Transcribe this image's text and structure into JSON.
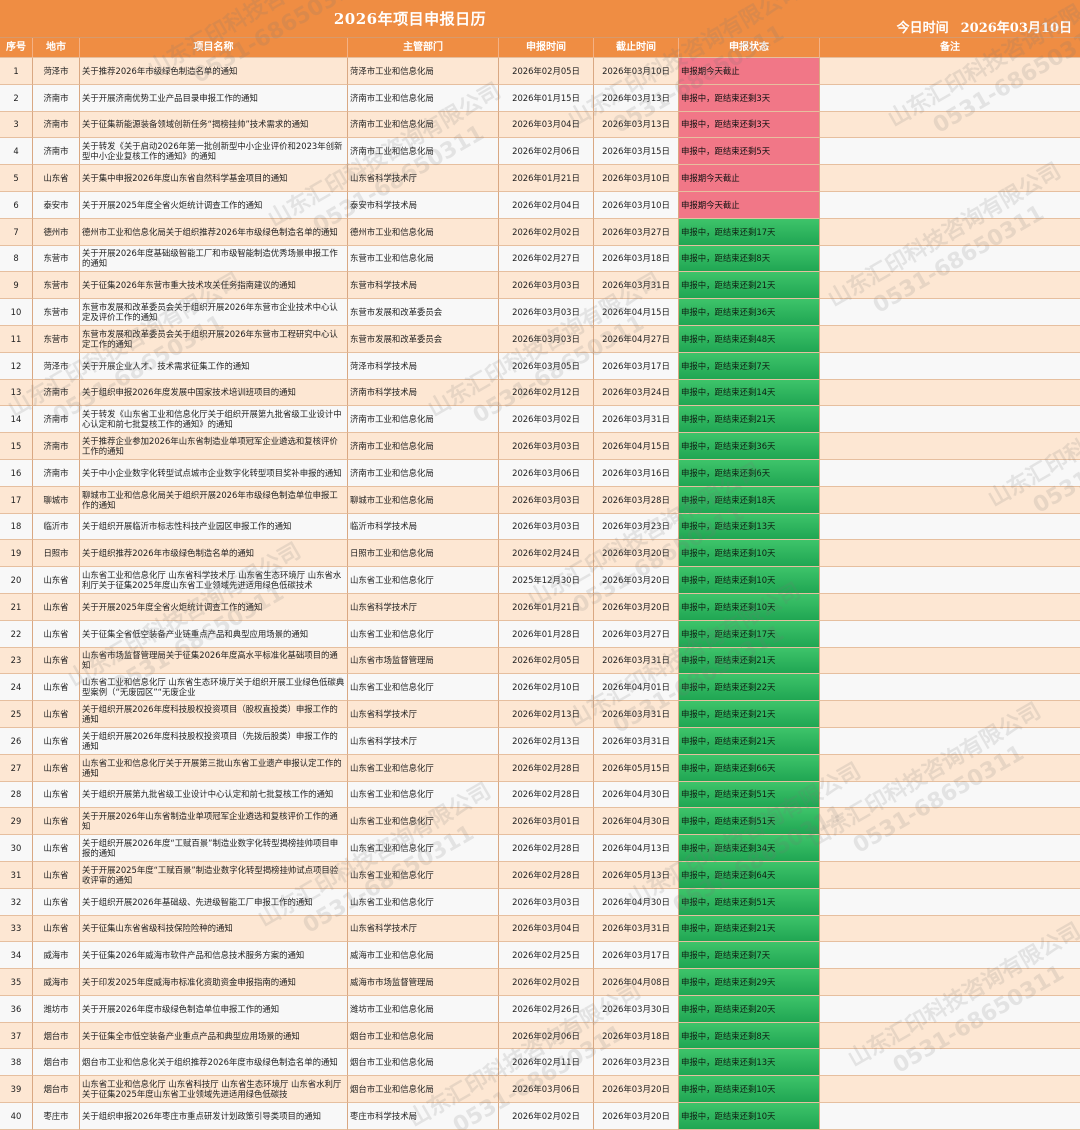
{
  "header": {
    "title": "2026年项目申报日历",
    "today_label": "今日时间",
    "today_value": "2026年03月10日"
  },
  "columns": [
    "序号",
    "地市",
    "项目名称",
    "主管部门",
    "申报时间",
    "截止时间",
    "申报状态",
    "备注"
  ],
  "colors": {
    "header": "#ef8d43",
    "due_today": "#f17787",
    "active": "#2fb55e",
    "row_alt": "#fde7d3"
  },
  "rows": [
    {
      "no": "1",
      "city": "菏泽市",
      "name": "关于推荐2026年市级绿色制造名单的通知",
      "dept": "菏泽市工业和信息化局",
      "start": "2026年02月05日",
      "end": "2026年03月10日",
      "status": "申报期今天截止",
      "kind": "due"
    },
    {
      "no": "2",
      "city": "济南市",
      "name": "关于开展济南优势工业产品目录申报工作的通知",
      "dept": "济南市工业和信息化局",
      "start": "2026年01月15日",
      "end": "2026年03月13日",
      "status": "申报中，距结束还剩3天",
      "kind": "due"
    },
    {
      "no": "3",
      "city": "济南市",
      "name": "关于征集新能源装备领域创新任务“揭榜挂帅”技术需求的通知",
      "dept": "济南市工业和信息化局",
      "start": "2026年03月04日",
      "end": "2026年03月13日",
      "status": "申报中，距结束还剩3天",
      "kind": "due"
    },
    {
      "no": "4",
      "city": "济南市",
      "name": "关于转发《关于启动2026年第一批创新型中小企业评价和2023年创新型中小企业复核工作的通知》的通知",
      "dept": "济南市工业和信息化局",
      "start": "2026年02月06日",
      "end": "2026年03月15日",
      "status": "申报中，距结束还剩5天",
      "kind": "due"
    },
    {
      "no": "5",
      "city": "山东省",
      "name": "关于集中申报2026年度山东省自然科学基金项目的通知",
      "dept": "山东省科学技术厅",
      "start": "2026年01月21日",
      "end": "2026年03月10日",
      "status": "申报期今天截止",
      "kind": "due"
    },
    {
      "no": "6",
      "city": "泰安市",
      "name": "关于开展2025年度全省火炬统计调查工作的通知",
      "dept": "泰安市科学技术局",
      "start": "2026年02月04日",
      "end": "2026年03月10日",
      "status": "申报期今天截止",
      "kind": "due"
    },
    {
      "no": "7",
      "city": "德州市",
      "name": "德州市工业和信息化局关于组织推荐2026年市级绿色制造名单的通知",
      "dept": "德州市工业和信息化局",
      "start": "2026年02月02日",
      "end": "2026年03月27日",
      "status": "申报中，距结束还剩17天",
      "kind": "active"
    },
    {
      "no": "8",
      "city": "东营市",
      "name": "关于开展2026年度基础级智能工厂和市级智能制造优秀场景申报工作的通知",
      "dept": "东营市工业和信息化局",
      "start": "2026年02月27日",
      "end": "2026年03月18日",
      "status": "申报中，距结束还剩8天",
      "kind": "active"
    },
    {
      "no": "9",
      "city": "东营市",
      "name": "关于征集2026年东营市重大技术攻关任务指南建议的通知",
      "dept": "东营市科学技术局",
      "start": "2026年03月03日",
      "end": "2026年03月31日",
      "status": "申报中，距结束还剩21天",
      "kind": "active"
    },
    {
      "no": "10",
      "city": "东营市",
      "name": "东营市发展和改革委员会关于组织开展2026年东营市企业技术中心认定及评价工作的通知",
      "dept": "东营市发展和改革委员会",
      "start": "2026年03月03日",
      "end": "2026年04月15日",
      "status": "申报中，距结束还剩36天",
      "kind": "active"
    },
    {
      "no": "11",
      "city": "东营市",
      "name": "东营市发展和改革委员会关于组织开展2026年东营市工程研究中心认定工作的通知",
      "dept": "东营市发展和改革委员会",
      "start": "2026年03月03日",
      "end": "2026年04月27日",
      "status": "申报中，距结束还剩48天",
      "kind": "active"
    },
    {
      "no": "12",
      "city": "菏泽市",
      "name": "关于开展企业人才、技术需求征集工作的通知",
      "dept": "菏泽市科学技术局",
      "start": "2026年03月05日",
      "end": "2026年03月17日",
      "status": "申报中，距结束还剩7天",
      "kind": "active"
    },
    {
      "no": "13",
      "city": "济南市",
      "name": "关于组织申报2026年度发展中国家技术培训班项目的通知",
      "dept": "济南市科学技术局",
      "start": "2026年02月12日",
      "end": "2026年03月24日",
      "status": "申报中，距结束还剩14天",
      "kind": "active"
    },
    {
      "no": "14",
      "city": "济南市",
      "name": "关于转发《山东省工业和信息化厅关于组织开展第九批省级工业设计中心认定和前七批复核工作的通知》的通知",
      "dept": "济南市工业和信息化局",
      "start": "2026年03月02日",
      "end": "2026年03月31日",
      "status": "申报中，距结束还剩21天",
      "kind": "active"
    },
    {
      "no": "15",
      "city": "济南市",
      "name": "关于推荐企业参加2026年山东省制造业单项冠军企业遴选和复核评价工作的通知",
      "dept": "济南市工业和信息化局",
      "start": "2026年03月03日",
      "end": "2026年04月15日",
      "status": "申报中，距结束还剩36天",
      "kind": "active"
    },
    {
      "no": "16",
      "city": "济南市",
      "name": "关于中小企业数字化转型试点城市企业数字化转型项目奖补申报的通知",
      "dept": "济南市工业和信息化局",
      "start": "2026年03月06日",
      "end": "2026年03月16日",
      "status": "申报中，距结束还剩6天",
      "kind": "active"
    },
    {
      "no": "17",
      "city": "聊城市",
      "name": "聊城市工业和信息化局关于组织开展2026年市级绿色制造单位申报工作的通知",
      "dept": "聊城市工业和信息化局",
      "start": "2026年03月03日",
      "end": "2026年03月28日",
      "status": "申报中，距结束还剩18天",
      "kind": "active"
    },
    {
      "no": "18",
      "city": "临沂市",
      "name": "关于组织开展临沂市标志性科技产业园区申报工作的通知",
      "dept": "临沂市科学技术局",
      "start": "2026年03月03日",
      "end": "2026年03月23日",
      "status": "申报中，距结束还剩13天",
      "kind": "active"
    },
    {
      "no": "19",
      "city": "日照市",
      "name": "关于组织推荐2026年市级绿色制造名单的通知",
      "dept": "日照市工业和信息化局",
      "start": "2026年02月24日",
      "end": "2026年03月20日",
      "status": "申报中，距结束还剩10天",
      "kind": "active"
    },
    {
      "no": "20",
      "city": "山东省",
      "name": "山东省工业和信息化厅 山东省科学技术厅 山东省生态环境厅 山东省水利厅关于征集2025年度山东省工业领域先进适用绿色低碳技术",
      "dept": "山东省工业和信息化厅",
      "start": "2025年12月30日",
      "end": "2026年03月20日",
      "status": "申报中，距结束还剩10天",
      "kind": "active"
    },
    {
      "no": "21",
      "city": "山东省",
      "name": "关于开展2025年度全省火炬统计调查工作的通知",
      "dept": "山东省科学技术厅",
      "start": "2026年01月21日",
      "end": "2026年03月20日",
      "status": "申报中，距结束还剩10天",
      "kind": "active"
    },
    {
      "no": "22",
      "city": "山东省",
      "name": "关于征集全省低空装备产业链重点产品和典型应用场景的通知",
      "dept": "山东省工业和信息化厅",
      "start": "2026年01月28日",
      "end": "2026年03月27日",
      "status": "申报中，距结束还剩17天",
      "kind": "active"
    },
    {
      "no": "23",
      "city": "山东省",
      "name": "山东省市场监督管理局关于征集2026年度高水平标准化基础项目的通知",
      "dept": "山东省市场监督管理局",
      "start": "2026年02月05日",
      "end": "2026年03月31日",
      "status": "申报中，距结束还剩21天",
      "kind": "active"
    },
    {
      "no": "24",
      "city": "山东省",
      "name": "山东省工业和信息化厅 山东省生态环境厅关于组织开展工业绿色低碳典型案例（“无废园区”“无废企业",
      "dept": "山东省工业和信息化厅",
      "start": "2026年02月10日",
      "end": "2026年04月01日",
      "status": "申报中，距结束还剩22天",
      "kind": "active"
    },
    {
      "no": "25",
      "city": "山东省",
      "name": "关于组织开展2026年度科技股权投资项目（股权直投类）申报工作的通知",
      "dept": "山东省科学技术厅",
      "start": "2026年02月13日",
      "end": "2026年03月31日",
      "status": "申报中，距结束还剩21天",
      "kind": "active"
    },
    {
      "no": "26",
      "city": "山东省",
      "name": "关于组织开展2026年度科技股权投资项目（先拨后股类）申报工作的通知",
      "dept": "山东省科学技术厅",
      "start": "2026年02月13日",
      "end": "2026年03月31日",
      "status": "申报中，距结束还剩21天",
      "kind": "active"
    },
    {
      "no": "27",
      "city": "山东省",
      "name": "山东省工业和信息化厅关于开展第三批山东省工业遗产申报认定工作的通知",
      "dept": "山东省工业和信息化厅",
      "start": "2026年02月28日",
      "end": "2026年05月15日",
      "status": "申报中，距结束还剩66天",
      "kind": "active"
    },
    {
      "no": "28",
      "city": "山东省",
      "name": "关于组织开展第九批省级工业设计中心认定和前七批复核工作的通知",
      "dept": "山东省工业和信息化厅",
      "start": "2026年02月28日",
      "end": "2026年04月30日",
      "status": "申报中，距结束还剩51天",
      "kind": "active"
    },
    {
      "no": "29",
      "city": "山东省",
      "name": "关于开展2026年山东省制造业单项冠军企业遴选和复核评价工作的通知",
      "dept": "山东省工业和信息化厅",
      "start": "2026年03月01日",
      "end": "2026年04月30日",
      "status": "申报中，距结束还剩51天",
      "kind": "active"
    },
    {
      "no": "30",
      "city": "山东省",
      "name": "关于组织开展2026年度“工赋百景”制造业数字化转型揭榜挂帅项目申报的通知",
      "dept": "山东省工业和信息化厅",
      "start": "2026年02月28日",
      "end": "2026年04月13日",
      "status": "申报中，距结束还剩34天",
      "kind": "active"
    },
    {
      "no": "31",
      "city": "山东省",
      "name": "关于开展2025年度“工赋百景”制造业数字化转型揭榜挂帅试点项目验收评审的通知",
      "dept": "山东省工业和信息化厅",
      "start": "2026年02月28日",
      "end": "2026年05月13日",
      "status": "申报中，距结束还剩64天",
      "kind": "active"
    },
    {
      "no": "32",
      "city": "山东省",
      "name": "关于组织开展2026年基础级、先进级智能工厂申报工作的通知",
      "dept": "山东省工业和信息化厅",
      "start": "2026年03月03日",
      "end": "2026年04月30日",
      "status": "申报中，距结束还剩51天",
      "kind": "active"
    },
    {
      "no": "33",
      "city": "山东省",
      "name": "关于征集山东省省级科技保险险种的通知",
      "dept": "山东省科学技术厅",
      "start": "2026年03月04日",
      "end": "2026年03月31日",
      "status": "申报中，距结束还剩21天",
      "kind": "active"
    },
    {
      "no": "34",
      "city": "威海市",
      "name": "关于征集2026年威海市软件产品和信息技术服务方案的通知",
      "dept": "威海市工业和信息化局",
      "start": "2026年02月25日",
      "end": "2026年03月17日",
      "status": "申报中，距结束还剩7天",
      "kind": "active"
    },
    {
      "no": "35",
      "city": "威海市",
      "name": "关于印发2025年度威海市标准化资助资金申报指南的通知",
      "dept": "威海市市场监督管理局",
      "start": "2026年02月02日",
      "end": "2026年04月08日",
      "status": "申报中，距结束还剩29天",
      "kind": "active"
    },
    {
      "no": "36",
      "city": "潍坊市",
      "name": "关于开展2026年度市级绿色制造单位申报工作的通知",
      "dept": "潍坊市工业和信息化局",
      "start": "2026年02月26日",
      "end": "2026年03月30日",
      "status": "申报中，距结束还剩20天",
      "kind": "active"
    },
    {
      "no": "37",
      "city": "烟台市",
      "name": "关于征集全市低空装备产业重点产品和典型应用场景的通知",
      "dept": "烟台市工业和信息化局",
      "start": "2026年02月06日",
      "end": "2026年03月18日",
      "status": "申报中，距结束还剩8天",
      "kind": "active"
    },
    {
      "no": "38",
      "city": "烟台市",
      "name": "烟台市工业和信息化关于组织推荐2026年度市级绿色制造名单的通知",
      "dept": "烟台市工业和信息化局",
      "start": "2026年02月11日",
      "end": "2026年03月23日",
      "status": "申报中，距结束还剩13天",
      "kind": "active"
    },
    {
      "no": "39",
      "city": "烟台市",
      "name": "山东省工业和信息化厅 山东省科技厅 山东省生态环境厅 山东省水利厅 关于征集2025年度山东省工业领域先进适用绿色低碳技",
      "dept": "烟台市工业和信息化局",
      "start": "2026年03月06日",
      "end": "2026年03月20日",
      "status": "申报中，距结束还剩10天",
      "kind": "active"
    },
    {
      "no": "40",
      "city": "枣庄市",
      "name": "关于组织申报2026年枣庄市重点研发计划政策引导类项目的通知",
      "dept": "枣庄市科学技术局",
      "start": "2026年02月02日",
      "end": "2026年03月20日",
      "status": "申报中，距结束还剩10天",
      "kind": "active"
    }
  ],
  "watermark": {
    "company": "山东汇印科技咨询有限公司",
    "phone": "0531-68650311"
  }
}
